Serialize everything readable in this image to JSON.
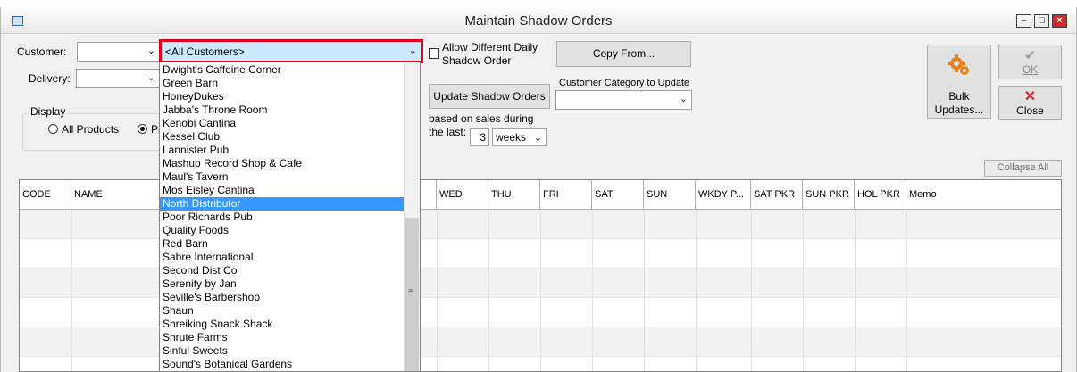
{
  "window": {
    "title": "Maintain Shadow Orders"
  },
  "form": {
    "customer_label": "Customer:",
    "delivery_label": "Delivery:",
    "customer_filter_value": "<All Customers>",
    "allow_different_label_line1": "Allow Different Daily",
    "allow_different_label_line2": "Shadow Order",
    "copy_from_label": "Copy From...",
    "update_shadow_label": "Update Shadow Orders",
    "category_label": "Customer Category to Update",
    "based_on_line1": "based on sales during",
    "based_on_line2": "the last:",
    "weeks_count": "3",
    "weeks_unit": "weeks",
    "display_label": "Display",
    "all_products_label": "All Products",
    "second_radio_partial": "Pr"
  },
  "buttons": {
    "bulk_line1": "Bulk",
    "bulk_line2": "Updates...",
    "ok_label": "OK",
    "close_label": "Close",
    "collapse_all": "Collapse All"
  },
  "dropdown": {
    "selected_index": 10,
    "items": [
      "Dwight's Caffeine Corner",
      "Green Barn",
      "HoneyDukes",
      "Jabba's Throne Room",
      "Kenobi Cantina",
      "Kessel Club",
      "Lannister Pub",
      "Mashup Record Shop & Cafe",
      "Maul's Tavern",
      "Mos Eisley Cantina",
      "North Distributor",
      "Poor Richards Pub",
      "Quality Foods",
      "Red Barn",
      "Sabre International",
      "Second Dist Co",
      "Serenity by Jan",
      "Seville's Barbershop",
      "Shaun",
      "Shreiking Snack Shack",
      "Shrute Farms",
      "Sinful Sweets",
      "Sound's Botanical Gardens"
    ]
  },
  "grid": {
    "columns": [
      "CODE",
      "NAME",
      "",
      "WED",
      "THU",
      "FRI",
      "SAT",
      "SUN",
      "WKDY P...",
      "SAT PKR",
      "SUN PKR",
      "HOL PKR",
      "Memo"
    ]
  },
  "colors": {
    "highlight_border": "#e0001a",
    "selection": "#3399ff",
    "close_x": "#d9262c",
    "gear": "#e8811a"
  }
}
